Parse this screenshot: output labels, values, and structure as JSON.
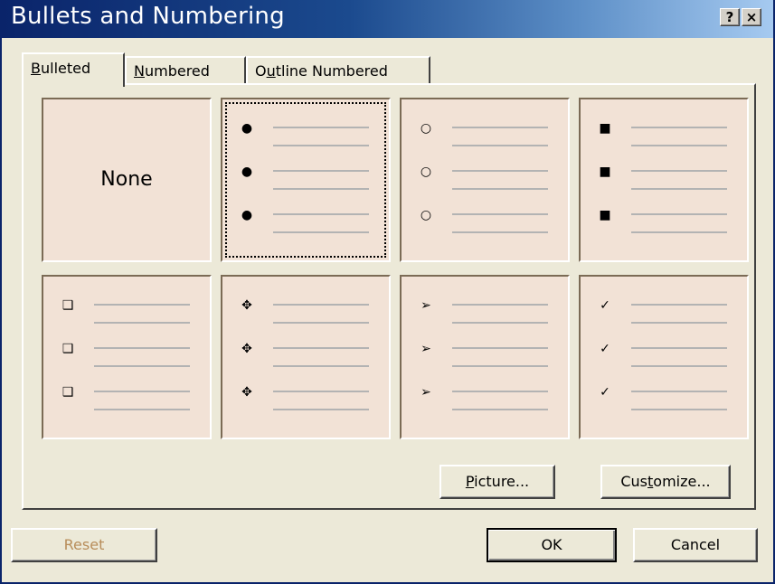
{
  "dialog": {
    "title": "Bullets and Numbering",
    "help_button": "?",
    "close_button": "×"
  },
  "tabs": [
    {
      "pre": "",
      "key": "B",
      "post": "ulleted",
      "active": true
    },
    {
      "pre": "",
      "key": "N",
      "post": "umbered",
      "active": false
    },
    {
      "pre": "O",
      "key": "u",
      "post": "tline Numbered",
      "active": false
    }
  ],
  "gallery": {
    "none_label": "None",
    "styles": [
      {
        "icon": "none",
        "glyph": ""
      },
      {
        "icon": "filled-circle-bullet-icon",
        "glyph": "●"
      },
      {
        "icon": "hollow-circle-bullet-icon",
        "glyph": "○"
      },
      {
        "icon": "square-bullet-icon",
        "glyph": "■"
      },
      {
        "icon": "checkbox-bullet-icon",
        "glyph": "❑"
      },
      {
        "icon": "four-diamond-bullet-icon",
        "glyph": "✥"
      },
      {
        "icon": "arrowhead-bullet-icon",
        "glyph": "➢"
      },
      {
        "icon": "checkmark-bullet-icon",
        "glyph": "✓"
      }
    ],
    "selected_index": 1
  },
  "buttons": {
    "picture": {
      "pre": "",
      "key": "P",
      "post": "icture..."
    },
    "customize": {
      "pre": "Cus",
      "key": "t",
      "post": "omize..."
    },
    "reset": "Reset",
    "ok": "OK",
    "cancel": "Cancel"
  },
  "colors": {
    "face": "#ece9d8",
    "cell_bg": "#f2e2d6",
    "title_start": "#0a246a",
    "title_end": "#a6caf0",
    "disabled_text": "#b88d5a"
  }
}
